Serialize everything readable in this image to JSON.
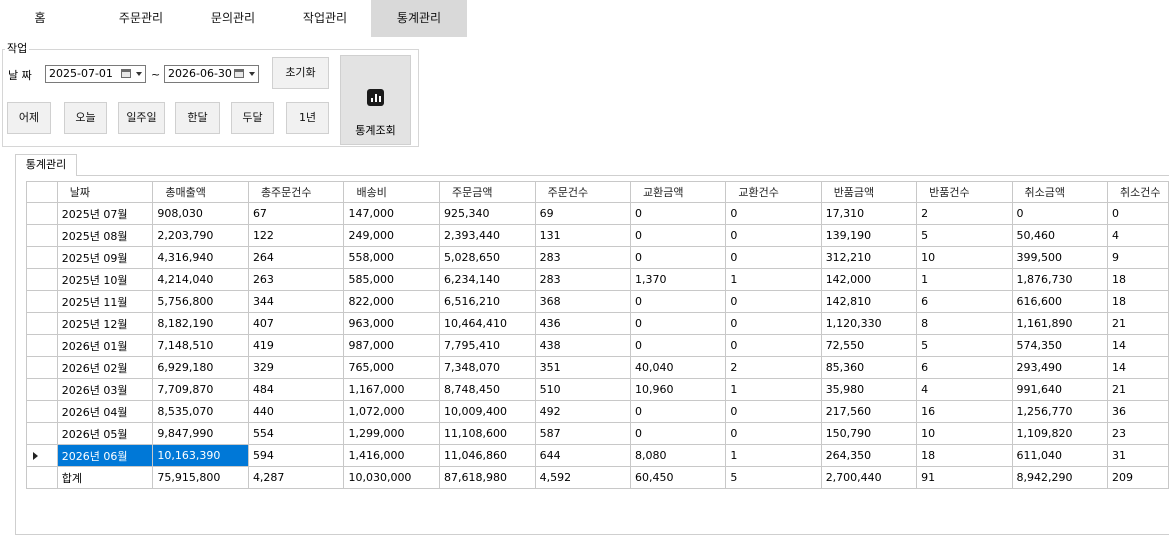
{
  "nav": {
    "tabs": [
      {
        "label": "홈"
      },
      {
        "label": "주문관리"
      },
      {
        "label": "문의관리"
      },
      {
        "label": "작업관리"
      },
      {
        "label": "통계관리",
        "active": true
      }
    ]
  },
  "filter": {
    "group_title": "작업",
    "date_label": "날 짜",
    "start_date": "2025-07-01",
    "tilde": "~",
    "end_date": "2026-06-30",
    "reset_label": "초기화",
    "quick_buttons": [
      "어제",
      "오늘",
      "일주일",
      "한달",
      "두달",
      "1년"
    ],
    "stats_label": "통계조회",
    "stats_icon": "bar-chart-icon"
  },
  "tab": {
    "label": "통계관리"
  },
  "grid": {
    "columns": [
      "날짜",
      "총매출액",
      "총주문건수",
      "배송비",
      "주문금액",
      "주문건수",
      "교환금액",
      "교환건수",
      "반품금액",
      "반품건수",
      "취소금액",
      "취소건수"
    ],
    "rows": [
      [
        "2025년 07월",
        "908,030",
        "67",
        "147,000",
        "925,340",
        "69",
        "0",
        "0",
        "17,310",
        "2",
        "0",
        "0"
      ],
      [
        "2025년 08월",
        "2,203,790",
        "122",
        "249,000",
        "2,393,440",
        "131",
        "0",
        "0",
        "139,190",
        "5",
        "50,460",
        "4"
      ],
      [
        "2025년 09월",
        "4,316,940",
        "264",
        "558,000",
        "5,028,650",
        "283",
        "0",
        "0",
        "312,210",
        "10",
        "399,500",
        "9"
      ],
      [
        "2025년 10월",
        "4,214,040",
        "263",
        "585,000",
        "6,234,140",
        "283",
        "1,370",
        "1",
        "142,000",
        "1",
        "1,876,730",
        "18"
      ],
      [
        "2025년 11월",
        "5,756,800",
        "344",
        "822,000",
        "6,516,210",
        "368",
        "0",
        "0",
        "142,810",
        "6",
        "616,600",
        "18"
      ],
      [
        "2025년 12월",
        "8,182,190",
        "407",
        "963,000",
        "10,464,410",
        "436",
        "0",
        "0",
        "1,120,330",
        "8",
        "1,161,890",
        "21"
      ],
      [
        "2026년 01월",
        "7,148,510",
        "419",
        "987,000",
        "7,795,410",
        "438",
        "0",
        "0",
        "72,550",
        "5",
        "574,350",
        "14"
      ],
      [
        "2026년 02월",
        "6,929,180",
        "329",
        "765,000",
        "7,348,070",
        "351",
        "40,040",
        "2",
        "85,360",
        "6",
        "293,490",
        "14"
      ],
      [
        "2026년 03월",
        "7,709,870",
        "484",
        "1,167,000",
        "8,748,450",
        "510",
        "10,960",
        "1",
        "35,980",
        "4",
        "991,640",
        "21"
      ],
      [
        "2026년 04월",
        "8,535,070",
        "440",
        "1,072,000",
        "10,009,400",
        "492",
        "0",
        "0",
        "217,560",
        "16",
        "1,256,770",
        "36"
      ],
      [
        "2026년 05월",
        "9,847,990",
        "554",
        "1,299,000",
        "11,108,600",
        "587",
        "0",
        "0",
        "150,790",
        "10",
        "1,109,820",
        "23"
      ],
      [
        "2026년 06월",
        "10,163,390",
        "594",
        "1,416,000",
        "11,046,860",
        "644",
        "8,080",
        "1",
        "264,350",
        "18",
        "611,040",
        "31"
      ],
      [
        "합계",
        "75,915,800",
        "4,287",
        "10,030,000",
        "87,618,980",
        "4,592",
        "60,450",
        "5",
        "2,700,440",
        "91",
        "8,942,290",
        "209"
      ]
    ],
    "selected_row": 11,
    "selection_color": "#0078d7"
  }
}
